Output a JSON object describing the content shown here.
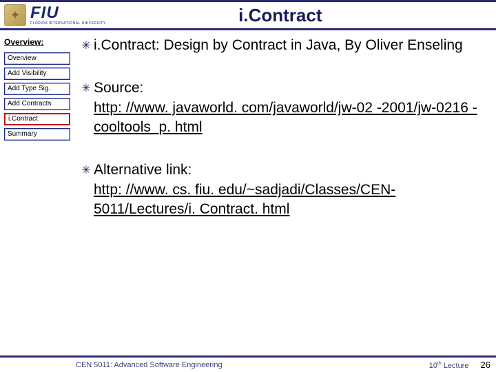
{
  "header": {
    "logo_glyph": "✦",
    "fiu_text": "FIU",
    "fiu_sub": "FLORIDA INTERNATIONAL UNIVERSITY",
    "title": "i.Contract"
  },
  "sidebar": {
    "heading": "Overview:",
    "items": [
      {
        "label": "Overview",
        "active": false
      },
      {
        "label": "Add Visibility",
        "active": false
      },
      {
        "label": "Add Type Sig.",
        "active": false
      },
      {
        "label": "Add Contracts",
        "active": false
      },
      {
        "label": "i.Contract",
        "active": true
      },
      {
        "label": "Summary",
        "active": false
      }
    ]
  },
  "content": {
    "bullets": [
      {
        "prefix": "",
        "text": "i.Contract: Design by Contract in Java, By Oliver Enseling",
        "link": ""
      },
      {
        "prefix": "Source: ",
        "text": "",
        "link": "http: //www. javaworld. com/javaworld/jw-02 -2001/jw-0216 -cooltools_p. html"
      },
      {
        "prefix": "Alternative link: ",
        "text": "",
        "link": "http: //www. cs. fiu. edu/~sadjadi/Classes/CEN-5011/Lectures/i. Contract. html"
      }
    ]
  },
  "footer": {
    "center": "CEN 5011: Advanced Software Engineering",
    "right_prefix": "10",
    "right_sup": "th",
    "right_suffix": " Lecture",
    "page": "26"
  }
}
